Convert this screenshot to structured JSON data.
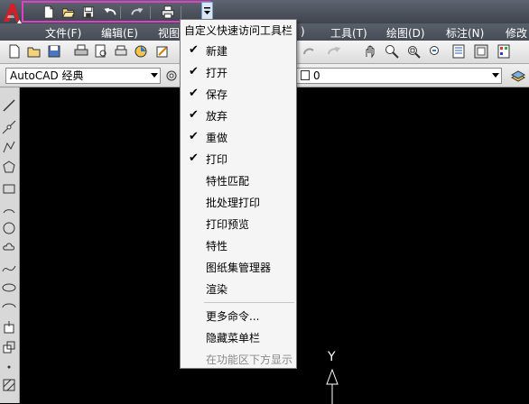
{
  "quick_access": {
    "icons": [
      "new-icon",
      "open-icon",
      "save-icon",
      "undo-icon",
      "redo-icon",
      "print-icon",
      "customize-dropdown-icon"
    ]
  },
  "menubar": {
    "items": [
      "文件(F)",
      "编辑(E)",
      "视图",
      ")",
      "工具(T)",
      "绘图(D)",
      "标注(N)",
      "修改"
    ]
  },
  "workspace_combo": {
    "value": "AutoCAD 经典"
  },
  "layer_combo": {
    "value": "0"
  },
  "dropdown": {
    "title": "自定义快速访问工具栏",
    "items": [
      {
        "label": "新建",
        "checked": "✔"
      },
      {
        "label": "打开",
        "checked": "✔"
      },
      {
        "label": "保存",
        "checked": "✔"
      },
      {
        "label": "放弃",
        "checked": "✔"
      },
      {
        "label": "重做",
        "checked": "✔"
      },
      {
        "label": "打印",
        "checked": "✔"
      },
      {
        "label": "特性匹配",
        "checked": ""
      },
      {
        "label": "批处理打印",
        "checked": ""
      },
      {
        "label": "打印预览",
        "checked": ""
      },
      {
        "label": "特性",
        "checked": ""
      },
      {
        "label": "图纸集管理器",
        "checked": ""
      },
      {
        "label": "渲染",
        "checked": ""
      }
    ],
    "extra": [
      {
        "label": "更多命令..."
      },
      {
        "label": "隐藏菜单栏"
      },
      {
        "label": "在功能区下方显示"
      }
    ]
  },
  "ucs": {
    "y_label": "Y"
  },
  "colors": {
    "highlight": "#e040c8",
    "background": "#000000"
  }
}
